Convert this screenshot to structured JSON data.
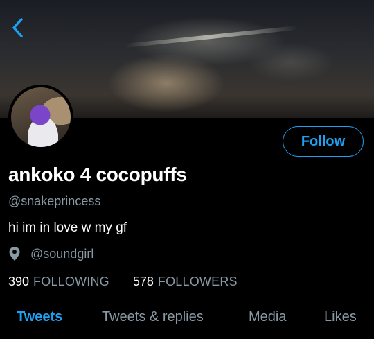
{
  "header": {
    "back_icon": "chevron-left-icon",
    "accent_color": "#1da1f2"
  },
  "profile": {
    "display_name": "ankoko 4 cocopuffs",
    "handle": "@snakeprincess",
    "bio": "hi im in love w my gf",
    "location": "@soundgirl",
    "location_icon": "location-pin-icon",
    "follow_label": "Follow"
  },
  "stats": {
    "following_count": "390",
    "following_label": "FOLLOWING",
    "followers_count": "578",
    "followers_label": "FOLLOWERS"
  },
  "tabs": [
    {
      "label": "Tweets",
      "active": true
    },
    {
      "label": "Tweets & replies",
      "active": false
    },
    {
      "label": "Media",
      "active": false
    },
    {
      "label": "Likes",
      "active": false
    }
  ]
}
